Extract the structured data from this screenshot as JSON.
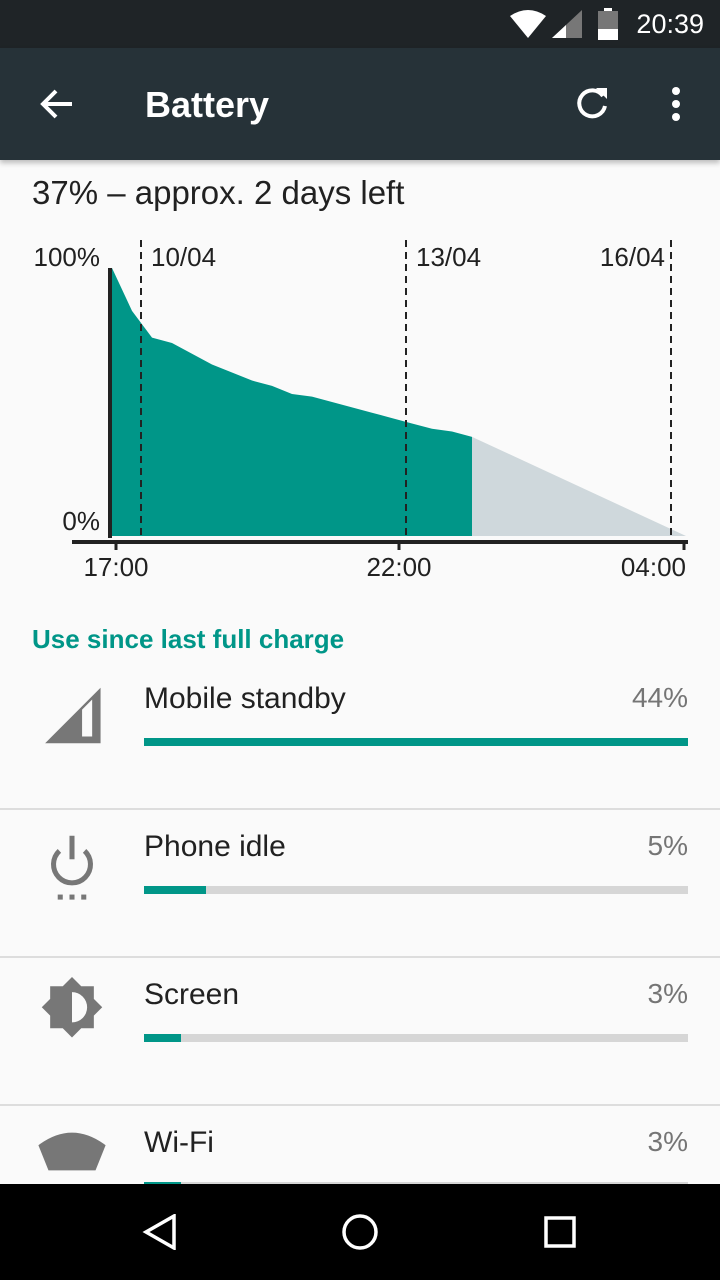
{
  "status_bar": {
    "time": "20:39"
  },
  "app_bar": {
    "title": "Battery",
    "back_icon": "arrow-back-icon",
    "refresh_icon": "refresh-icon",
    "menu_icon": "more-vert-icon"
  },
  "summary": "37% – approx. 2 days left",
  "chart_data": {
    "type": "area",
    "y_labels": [
      "100%",
      "0%"
    ],
    "ylim": [
      0,
      100
    ],
    "x_labels": [
      "17:00",
      "22:00",
      "04:00"
    ],
    "date_markers": [
      "10/04",
      "13/04",
      "16/04"
    ],
    "history_levels": [
      100,
      84,
      74,
      72,
      68,
      64,
      61,
      58,
      56,
      53,
      52,
      50,
      48,
      46,
      44,
      42,
      40,
      39,
      37
    ],
    "prediction": {
      "start": 37,
      "end": 0
    },
    "colors": {
      "history": "#009688",
      "prediction": "#cfd8dc"
    }
  },
  "section_title": "Use since last full charge",
  "items": [
    {
      "label": "Mobile standby",
      "percent": "44%",
      "value": 44,
      "icon": "cell-signal-icon"
    },
    {
      "label": "Phone idle",
      "percent": "5%",
      "value": 5,
      "icon": "power-idle-icon"
    },
    {
      "label": "Screen",
      "percent": "3%",
      "value": 3,
      "icon": "brightness-icon"
    },
    {
      "label": "Wi-Fi",
      "percent": "3%",
      "value": 3,
      "icon": "wifi-icon"
    }
  ],
  "accent": "#009688"
}
